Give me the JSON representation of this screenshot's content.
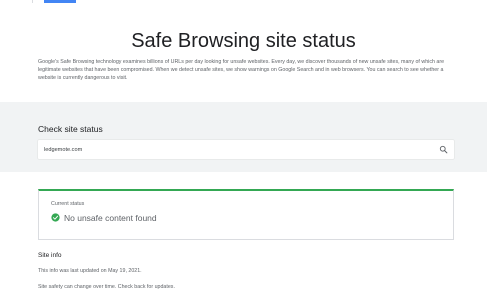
{
  "page": {
    "title": "Safe Browsing site status",
    "intro": "Google's Safe Browsing technology examines billions of URLs per day looking for unsafe websites. Every day, we discover thousands of new unsafe sites, many of which are legitimate websites that have been compromised. When we detect unsafe sites, we show warnings on Google Search and in web browsers. You can search to see whether a website is currently dangerous to visit."
  },
  "check": {
    "heading": "Check site status",
    "input_value": "ledgemote.com",
    "search_icon": "search-icon"
  },
  "status": {
    "label": "Current status",
    "icon": "check-circle-icon",
    "text": "No unsafe content found",
    "accent_color": "#34a853"
  },
  "site_info": {
    "heading": "Site info",
    "updated": "This info was last updated on May 19, 2021.",
    "note": "Site safety can change over time. Check back for updates."
  },
  "colors": {
    "accent_blue": "#4285f4",
    "band_gray": "#f1f3f4",
    "status_green": "#34a853"
  }
}
